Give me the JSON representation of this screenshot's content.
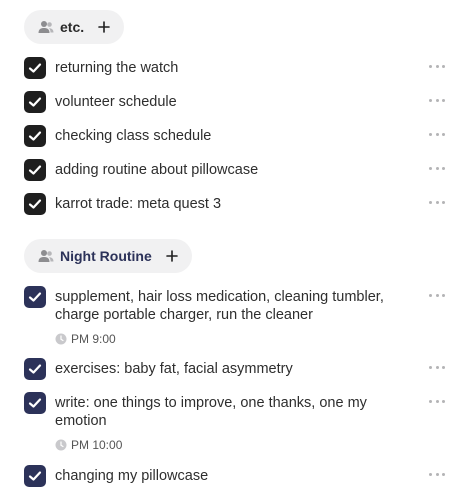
{
  "groups": [
    {
      "title": "etc.",
      "checkbox_color": "#1f1f1f",
      "title_color": "#2b2b2b",
      "tasks": [
        {
          "text": "returning the watch"
        },
        {
          "text": "volunteer schedule"
        },
        {
          "text": "checking class schedule"
        },
        {
          "text": "adding routine about pillowcase"
        },
        {
          "text": "karrot trade: meta quest 3"
        }
      ]
    },
    {
      "title": "Night Routine",
      "checkbox_color": "#2c3259",
      "title_color": "#2c3259",
      "tasks": [
        {
          "text": "supplement, hair loss medication, cleaning tumbler, charge portable charger, run the cleaner",
          "time": "PM 9:00"
        },
        {
          "text": "exercises: baby fat, facial asymmetry"
        },
        {
          "text": "write: one things to improve, one thanks, one my emotion",
          "time": "PM 10:00"
        },
        {
          "text": "changing my pillowcase"
        }
      ]
    }
  ]
}
